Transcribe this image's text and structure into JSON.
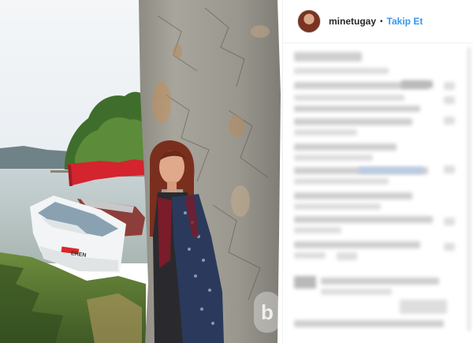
{
  "post": {
    "username": "minetugay",
    "separator": "•",
    "follow_label": "Takip Et",
    "boat_name": "EREN",
    "watermark": "b"
  },
  "colors": {
    "link": "#3897f0",
    "text": "#262626",
    "divider": "#efefef"
  },
  "icons": [
    "avatar",
    "watermark-logo"
  ]
}
